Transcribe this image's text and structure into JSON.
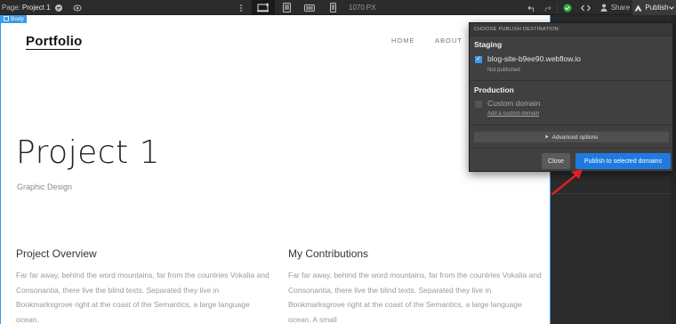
{
  "toolbar": {
    "page_label": "Page:",
    "page_name": "Project 1",
    "width_value": "1070",
    "width_unit": "PX",
    "share_label": "Share",
    "publish_label": "Publish"
  },
  "canvas": {
    "body_tag": "Body",
    "logo": "Portfolio",
    "nav": [
      "HOME",
      "ABOUT"
    ],
    "project_title": "Project 1",
    "project_subtitle": "Graphic Design",
    "columns": [
      {
        "title": "Project Overview",
        "text": "Far far away, behind the word mountains, far from the countries Vokalia and Consonantia, there live the blind texts. Separated they live in Bookmarksgrove right at the coast of the Semantics, a large language ocean."
      },
      {
        "title": "My Contributions",
        "text": "Far far away, behind the word mountains, far from the countries Vokalia and Consonantia, there live the blind texts. Separated they live in Bookmarksgrove right at the coast of the Semantics, a large language ocean. A small"
      }
    ]
  },
  "publish_menu": {
    "header": "CHOOSE PUBLISH DESTINATION:",
    "staging": {
      "title": "Staging",
      "domain": "blog-site-b9ee90.webflow.io",
      "checked": true,
      "status": "Not published"
    },
    "production": {
      "title": "Production",
      "domain": "Custom domain",
      "checked": false,
      "link": "Add a custom domain"
    },
    "advanced_label": "Advanced options",
    "close_label": "Close",
    "publish_label": "Publish to selected domains"
  },
  "colors": {
    "accent": "#3b9ae8",
    "publish_button": "#1f7ae0",
    "arrow": "#e02020",
    "status_ok": "#2fb344"
  }
}
